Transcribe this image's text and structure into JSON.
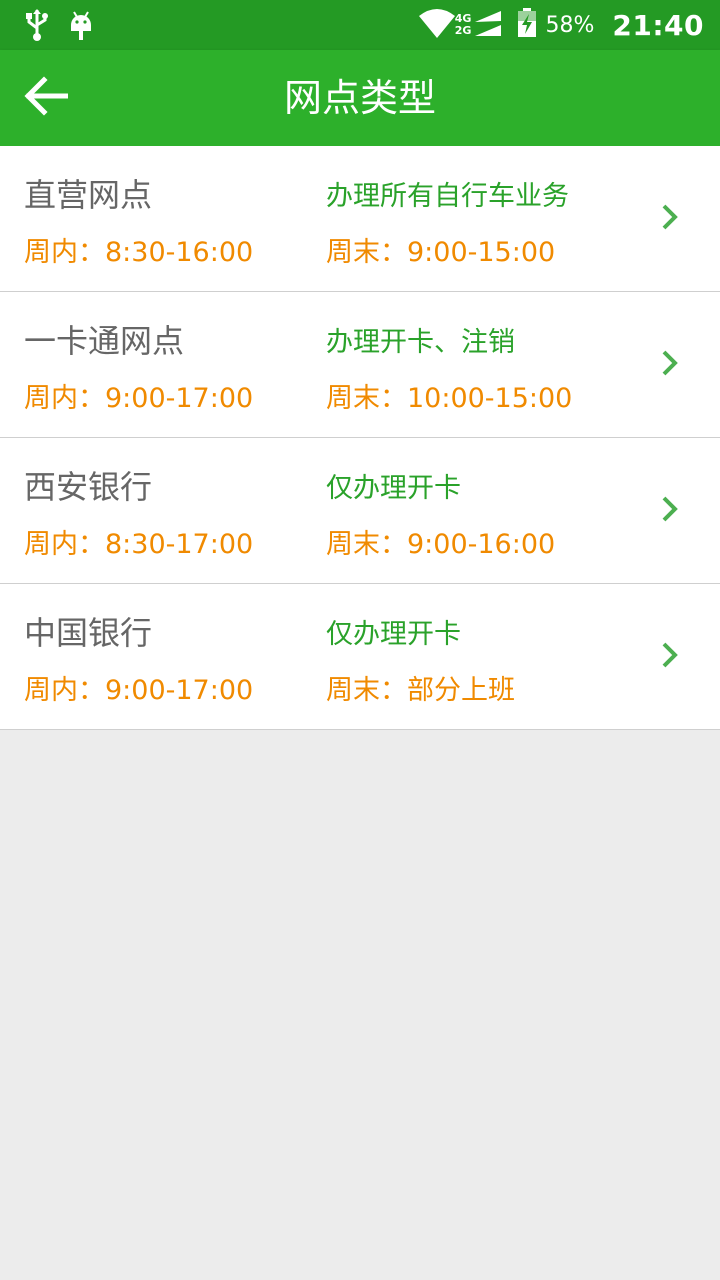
{
  "status_bar": {
    "network_top": "4G",
    "network_bottom": "2G",
    "battery": "58%",
    "time": "21:40",
    "icons": [
      "usb-icon",
      "android-icon",
      "wifi-icon",
      "signal-icon",
      "battery-charging-icon"
    ]
  },
  "app_bar": {
    "title": "网点类型",
    "back_icon": "arrow-left-icon"
  },
  "outlets": [
    {
      "name": "直营网点",
      "weekday": "周内：8:30-16:00",
      "service": "办理所有自行车业务",
      "weekend": "周末：9:00-15:00"
    },
    {
      "name": "一卡通网点",
      "weekday": "周内：9:00-17:00",
      "service": "办理开卡、注销",
      "weekend": "周末：10:00-15:00"
    },
    {
      "name": "西安银行",
      "weekday": "周内：8:30-17:00",
      "service": "仅办理开卡",
      "weekend": "周末：9:00-16:00"
    },
    {
      "name": "中国银行",
      "weekday": "周内：9:00-17:00",
      "service": "仅办理开卡",
      "weekend": "周末：部分上班"
    }
  ],
  "colors": {
    "status_bar": "#249a24",
    "app_bar": "#2db02b",
    "name_text": "#666666",
    "time_text": "#f08a00",
    "service_text": "#2aa22a",
    "chevron": "#4caf50",
    "background": "#ececec"
  }
}
